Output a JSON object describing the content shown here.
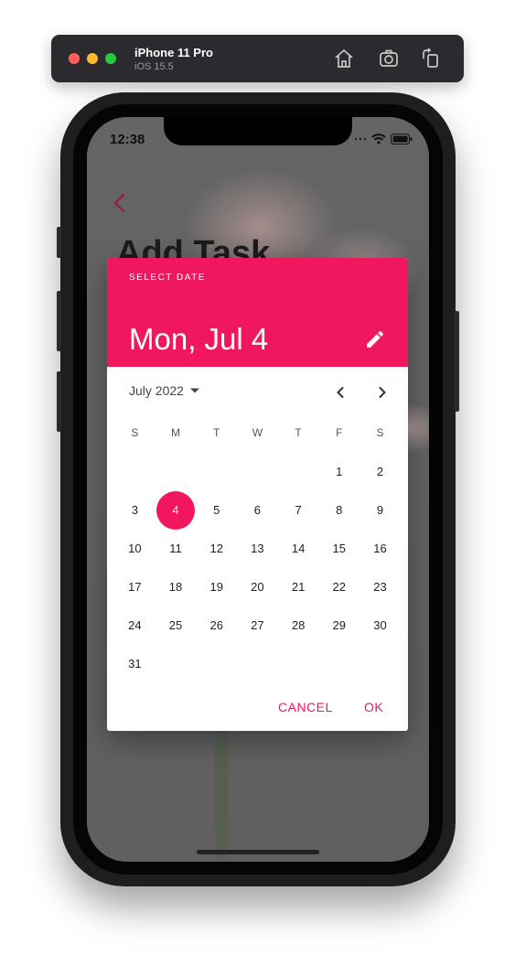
{
  "simulator": {
    "device_name": "iPhone 11 Pro",
    "os_version": "iOS 15.5",
    "toolbar_icons": [
      "home-icon",
      "screenshot-icon",
      "rotate-icon"
    ]
  },
  "status_bar": {
    "time": "12:38"
  },
  "page": {
    "title": "Add Task"
  },
  "date_picker": {
    "help_text": "SELECT DATE",
    "header_date": "Mon, Jul 4",
    "month_label": "July 2022",
    "weekdays": [
      "S",
      "M",
      "T",
      "W",
      "T",
      "F",
      "S"
    ],
    "weeks": [
      [
        "",
        "",
        "",
        "",
        "",
        "1",
        "2"
      ],
      [
        "3",
        "4",
        "5",
        "6",
        "7",
        "8",
        "9"
      ],
      [
        "10",
        "11",
        "12",
        "13",
        "14",
        "15",
        "16"
      ],
      [
        "17",
        "18",
        "19",
        "20",
        "21",
        "22",
        "23"
      ],
      [
        "24",
        "25",
        "26",
        "27",
        "28",
        "29",
        "30"
      ],
      [
        "31",
        "",
        "",
        "",
        "",
        "",
        ""
      ]
    ],
    "selected_day": "4",
    "cancel_label": "CANCEL",
    "ok_label": "OK",
    "accent_color": "#f1175e"
  }
}
